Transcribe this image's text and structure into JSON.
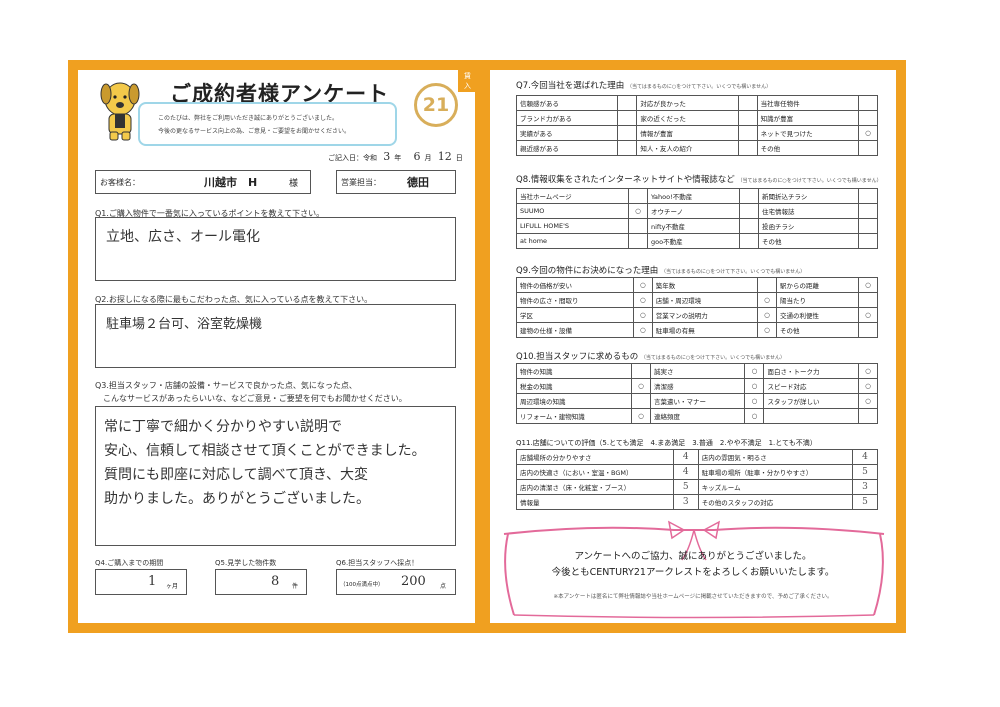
{
  "header": {
    "title": "ご成約者様アンケート",
    "tag": "賃入",
    "intro1": "このたびは、弊社をご利用いただき誠にありがとうございました。",
    "intro2": "今後の更なるサービス向上の為、ご意見・ご要望をお聞かせください。",
    "logo": "21",
    "date_label": "ご記入日：令和",
    "date_year": "3",
    "date_year_unit": "年",
    "date_month": "6",
    "date_month_unit": "月",
    "date_day": "12",
    "date_day_unit": "日"
  },
  "customer": {
    "name_label": "お客様名：",
    "name_value": "川越市　H",
    "suffix": "様",
    "staff_label": "営業担当：",
    "staff_value": "德田"
  },
  "q1": {
    "question": "Q1.ご購入物件で一番気に入っているポイントを教えて下さい。",
    "answer": "立地、広さ、オール電化"
  },
  "q2": {
    "question": "Q2.お探しになる際に最もこだわった点、気に入っている点を教えて下さい。",
    "answer": "駐車場２台可、浴室乾燥機"
  },
  "q3": {
    "question1": "Q3.担当スタッフ・店舗の設備・サービスで良かった点、気になった点、",
    "question2": "　こんなサービスがあったらいいな、などご意見・ご要望を何でもお聞かせください。",
    "lines": [
      "常に丁寧で細かく分かりやすい説明で",
      "安心、信頼して相談させて頂くことができました。",
      "質問にも即座に対応して調べて頂き、大変",
      "助かりました。ありがとうございました。"
    ]
  },
  "q4": {
    "question": "Q4.ご購入までの期間",
    "value": "1",
    "unit": "ヶ月"
  },
  "q5": {
    "question": "Q5.見学した物件数",
    "value": "8",
    "unit": "件"
  },
  "q6": {
    "question": "Q6.担当スタッフへ採点！",
    "note": "（100点満点中）",
    "value": "200",
    "unit": "点"
  },
  "q7": {
    "question": "Q7.今回当社を選ばれた理由",
    "note": "（当てはまるものに○をつけて下さい。いくつでも構いません）",
    "rows": [
      [
        "信頼感がある",
        "",
        "対応が良かった",
        "",
        "当社専任物件",
        ""
      ],
      [
        "ブランド力がある",
        "",
        "家の近くだった",
        "",
        "知識が豊富",
        ""
      ],
      [
        "実績がある",
        "",
        "情報が豊富",
        "",
        "ネットで見つけた",
        "○"
      ],
      [
        "親近感がある",
        "",
        "知人・友人の紹介",
        "",
        "その他",
        ""
      ]
    ]
  },
  "q8": {
    "question": "Q8.情報収集をされたインターネットサイトや情報誌など",
    "note": "（当てはまるものに○をつけて下さい。いくつでも構いません）",
    "rows": [
      [
        "当社ホームページ",
        "",
        "Yahoo!不動産",
        "",
        "新聞折込チラシ",
        ""
      ],
      [
        "SUUMO",
        "○",
        "オウチーノ",
        "",
        "住宅情報誌",
        ""
      ],
      [
        "LIFULL HOME'S",
        "",
        "nifty不動産",
        "",
        "投函チラシ",
        ""
      ],
      [
        "at home",
        "",
        "goo不動産",
        "",
        "その他",
        ""
      ]
    ]
  },
  "q9": {
    "question": "Q9.今回の物件にお決めになった理由",
    "note": "（当てはまるものに○をつけて下さい。いくつでも構いません）",
    "rows": [
      [
        "物件の価格が安い",
        "○",
        "築年数",
        "",
        "駅からの距離",
        "○"
      ],
      [
        "物件の広さ・間取り",
        "○",
        "店舗・周辺環境",
        "○",
        "陽当たり",
        ""
      ],
      [
        "学区",
        "○",
        "営業マンの説明力",
        "○",
        "交通の利便性",
        "○"
      ],
      [
        "建物の仕様・設備",
        "○",
        "駐車場の有無",
        "○",
        "その他",
        ""
      ]
    ]
  },
  "q10": {
    "question": "Q10.担当スタッフに求めるもの",
    "note": "（当てはまるものに○をつけて下さい。いくつでも構いません）",
    "rows": [
      [
        "物件の知識",
        "",
        "誠実さ",
        "○",
        "面白さ・トーク力",
        "○"
      ],
      [
        "税金の知識",
        "○",
        "清潔感",
        "○",
        "スピード対応",
        "○"
      ],
      [
        "周辺環境の知識",
        "",
        "言葉遣い・マナー",
        "○",
        "スタッフが詳しい",
        "○"
      ],
      [
        "リフォーム・建物知識",
        "○",
        "連絡頻度",
        "○",
        "",
        ""
      ]
    ]
  },
  "q11": {
    "question": "Q11.店舗についての評価（5.とても満足　4.まあ満足　3.普通　2.やや不満足　1.とても不満）",
    "rows": [
      [
        "店舗場所の分かりやすさ",
        "4",
        "店内の雰囲気・明るさ",
        "4"
      ],
      [
        "店内の快適さ（におい・室温・BGM）",
        "4",
        "駐車場の場所（駐車・分かりやすさ）",
        "5"
      ],
      [
        "店内の清潔さ（床・化粧室・ブース）",
        "5",
        "キッズルーム",
        "3"
      ],
      [
        "情報量",
        "3",
        "その他のスタッフの対応",
        "5"
      ]
    ]
  },
  "thanks": {
    "line1": "アンケートへのご協力、誠にありがとうございました。",
    "line2": "今後ともCENTURY21アークレストをよろしくお願いいたします。",
    "footnote": "※本アンケートは匿名にて弊社情報誌や当社ホームページに掲載させていただきますので、予めご了承ください。"
  }
}
